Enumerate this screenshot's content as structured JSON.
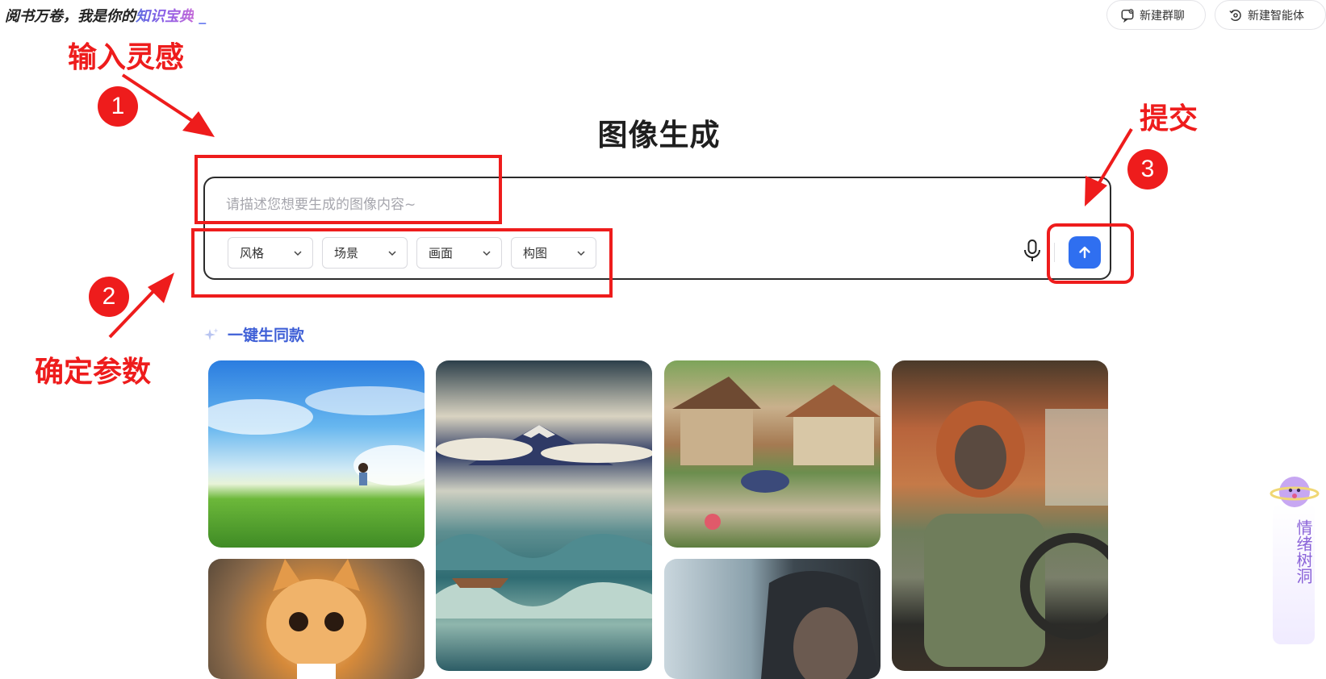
{
  "header": {
    "slogan_prefix": "阅书万卷，我是你的",
    "slogan_highlight": "知识宝典",
    "slogan_cursor": "_",
    "new_group_chat": "新建群聊",
    "new_agent": "新建智能体"
  },
  "page_title": "图像生成",
  "prompt": {
    "placeholder": "请描述您想要生成的图像内容~",
    "value": ""
  },
  "params": [
    {
      "label": "风格"
    },
    {
      "label": "场景"
    },
    {
      "label": "画面"
    },
    {
      "label": "构图"
    }
  ],
  "send_icon": "arrow-up-icon",
  "mic_icon": "microphone-icon",
  "section": {
    "label": "一键生同款",
    "icon": "sparkle-icon"
  },
  "gallery": [
    {
      "subject": "boy-running-on-grass-under-sky"
    },
    {
      "subject": "wave-and-mountain-ukiyoe"
    },
    {
      "subject": "rural-village-house"
    },
    {
      "subject": "orangutan-driving-car"
    },
    {
      "subject": "kitten-in-shirt"
    },
    {
      "subject": "man-by-rainy-window"
    }
  ],
  "side_widget": {
    "label": "情绪树洞"
  },
  "annotations": {
    "step1_text": "输入灵感",
    "step1_num": "1",
    "step2_text": "确定参数",
    "step2_num": "2",
    "step3_text": "提交",
    "step3_num": "3",
    "color": "#ee1c1c"
  },
  "colors": {
    "accent_blue": "#2f6ff0",
    "section_blue": "#3e5fd6",
    "widget_purple": "#8a63d8"
  }
}
